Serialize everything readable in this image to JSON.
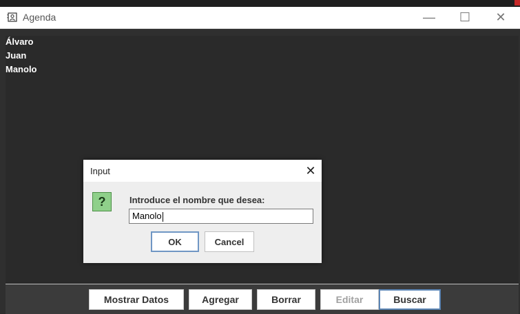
{
  "window": {
    "title": "Agenda",
    "controls": {
      "minimize": "—",
      "maximize": "☐",
      "close": "✕"
    }
  },
  "contacts": [
    "Álvaro",
    "Juan",
    "Manolo"
  ],
  "toolbar": {
    "buttons": [
      {
        "label": "Mostrar Datos",
        "enabled": true
      },
      {
        "label": "Agregar",
        "enabled": true
      },
      {
        "label": "Borrar",
        "enabled": true
      },
      {
        "label": "Editar",
        "enabled": false
      },
      {
        "label": "Buscar",
        "enabled": true
      }
    ]
  },
  "dialog": {
    "title": "Input",
    "close": "✕",
    "icon": "?",
    "prompt": "Introduce el nombre que desea:",
    "value": "Manolo",
    "ok": "OK",
    "cancel": "Cancel"
  },
  "colors": {
    "question_icon": "#8fd08a"
  }
}
